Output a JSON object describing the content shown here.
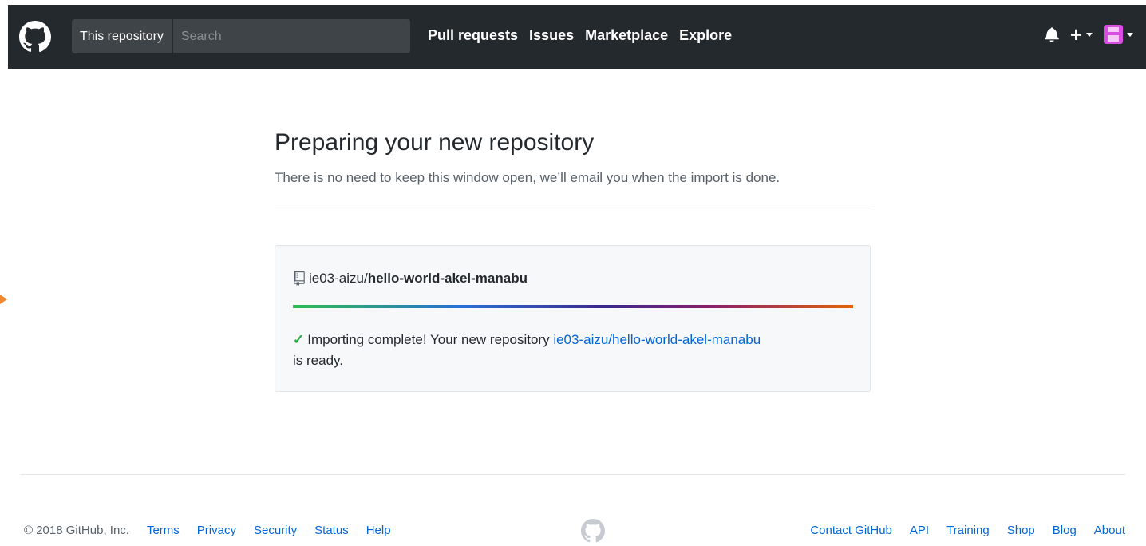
{
  "header": {
    "search_scope": "This repository",
    "search_placeholder": "Search",
    "nav": [
      "Pull requests",
      "Issues",
      "Marketplace",
      "Explore"
    ],
    "icons": [
      "github-logo-icon",
      "bell-icon",
      "plus-icon",
      "avatar"
    ]
  },
  "main": {
    "title": "Preparing your new repository",
    "subtitle": "There is no need to keep this window open, we’ll email you when the import is done.",
    "repo": {
      "owner": "ie03-aizu/",
      "name": "hello-world-akel-manabu"
    },
    "progress_fraction": 1,
    "status": {
      "message": "Importing complete! Your new repository",
      "link": "ie03-aizu/hello-world-akel-manabu",
      "suffix": "is ready."
    }
  },
  "footer": {
    "copyright": "© 2018 GitHub, Inc.",
    "left_links": [
      "Terms",
      "Privacy",
      "Security",
      "Status",
      "Help"
    ],
    "right_links": [
      "Contact GitHub",
      "API",
      "Training",
      "Shop",
      "Blog",
      "About"
    ]
  },
  "colors": {
    "header_bg": "#24292e",
    "link": "#0366d6",
    "success": "#28a745",
    "marker": "#f0882f"
  }
}
